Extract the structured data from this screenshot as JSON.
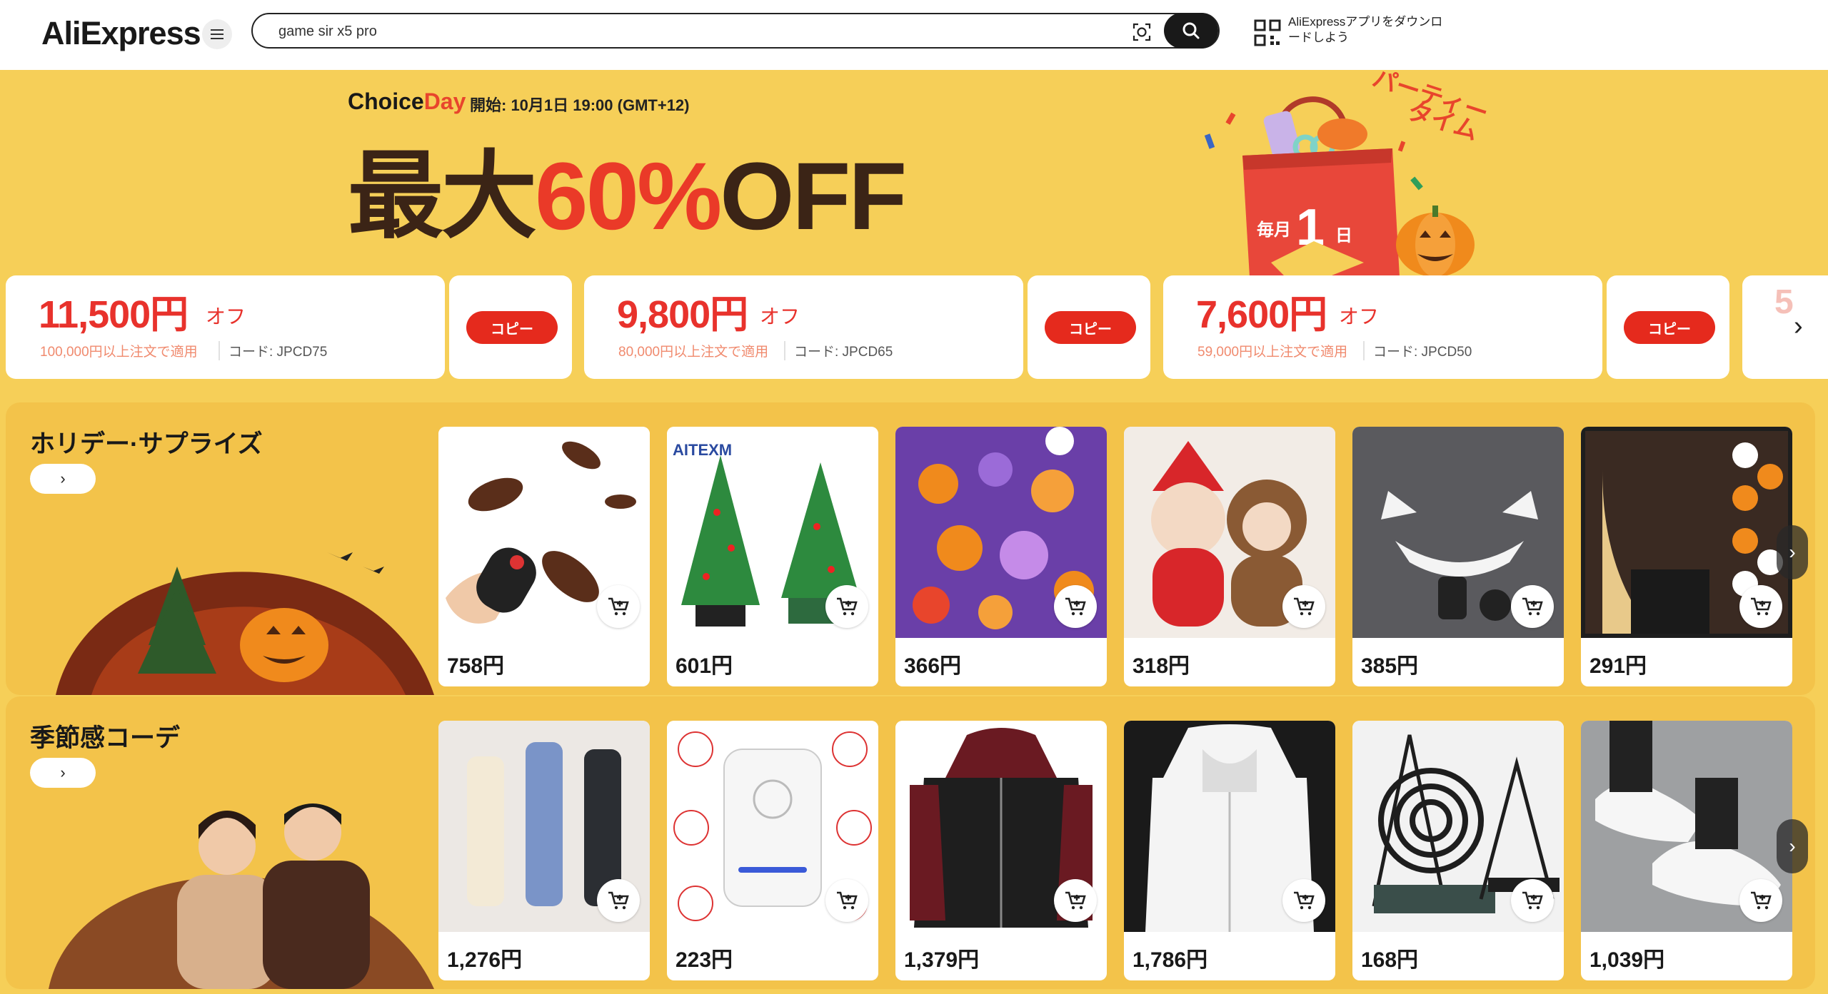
{
  "header": {
    "logo": "AliExpress",
    "search_value": "game sir x5 pro",
    "app_promo": "AliExpressアプリをダウンロードしよう"
  },
  "banner": {
    "choice_brand": "Choice",
    "choice_day": "Day",
    "event_start": "開始: 10月1日 19:00 (GMT+12)",
    "headline_pre": "最大",
    "headline_accent": "60%",
    "headline_post": "OFF",
    "badge_top": "パーティー",
    "badge_bottom": "タイム",
    "bag_pre": "毎月",
    "bag_num": "1",
    "bag_post": "日"
  },
  "coupons": [
    {
      "amount": "11,500円",
      "off": "オフ",
      "condition": "100,000円以上注文で適用",
      "code": "コード: JPCD75",
      "button": "コピー"
    },
    {
      "amount": "9,800円",
      "off": "オフ",
      "condition": "80,000円以上注文で適用",
      "code": "コード: JPCD65",
      "button": "コピー"
    },
    {
      "amount": "7,600円",
      "off": "オフ",
      "condition": "59,000円以上注文で適用",
      "code": "コード: JPCD50",
      "button": "コピー"
    }
  ],
  "coupon_peek": "5",
  "sections": [
    {
      "title": "ホリデー·サプライズ",
      "more": "›",
      "products": [
        {
          "price": "758円",
          "icon": "cockroach-toy-image"
        },
        {
          "price": "601円",
          "icon": "led-christmas-tree-kit-image"
        },
        {
          "price": "366円",
          "icon": "halloween-rings-image"
        },
        {
          "price": "318円",
          "icon": "plush-dolls-image"
        },
        {
          "price": "385円",
          "icon": "halloween-projector-image"
        },
        {
          "price": "291円",
          "icon": "halloween-hair-clips-image"
        }
      ],
      "brand_label": "AITEXM"
    },
    {
      "title": "季節感コーデ",
      "more": "›",
      "products": [
        {
          "price": "1,276円",
          "icon": "umbrellas-image"
        },
        {
          "price": "223円",
          "icon": "pest-repeller-image"
        },
        {
          "price": "1,379円",
          "icon": "hoodie-jacket-image"
        },
        {
          "price": "1,786円",
          "icon": "white-hoodie-image"
        },
        {
          "price": "168円",
          "icon": "mosquito-coil-holder-image"
        },
        {
          "price": "1,039円",
          "icon": "white-sneakers-image"
        }
      ]
    }
  ],
  "colors": {
    "banner_bg": "#f6cf58",
    "row_bg": "#f3c34a",
    "accent_red": "#e8322c",
    "copy_button": "#e52a1d"
  }
}
